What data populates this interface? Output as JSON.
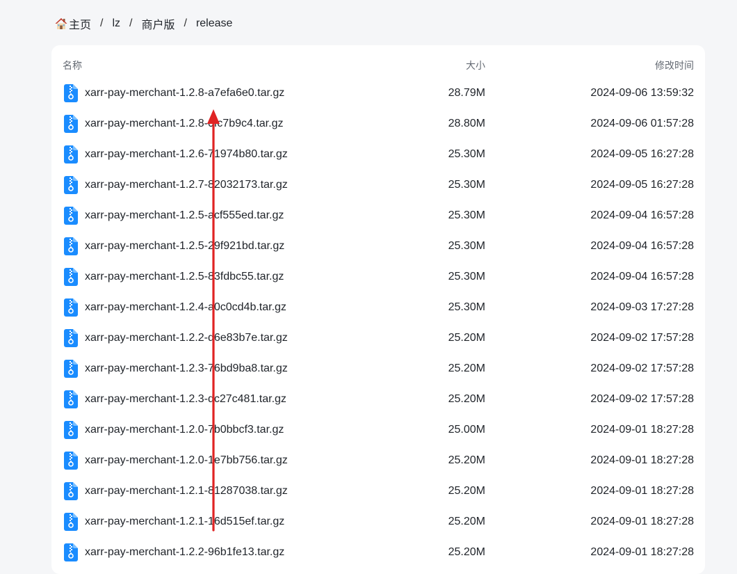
{
  "breadcrumb": {
    "home_label": "主页",
    "items": [
      "lz",
      "商户版",
      "release"
    ],
    "separator": "/"
  },
  "table": {
    "headers": {
      "name": "名称",
      "size": "大小",
      "modified": "修改时间"
    },
    "rows": [
      {
        "name": "xarr-pay-merchant-1.2.8-a7efa6e0.tar.gz",
        "size": "28.79M",
        "modified": "2024-09-06 13:59:32"
      },
      {
        "name": "xarr-pay-merchant-1.2.8-0fc7b9c4.tar.gz",
        "size": "28.80M",
        "modified": "2024-09-06 01:57:28"
      },
      {
        "name": "xarr-pay-merchant-1.2.6-71974b80.tar.gz",
        "size": "25.30M",
        "modified": "2024-09-05 16:27:28"
      },
      {
        "name": "xarr-pay-merchant-1.2.7-82032173.tar.gz",
        "size": "25.30M",
        "modified": "2024-09-05 16:27:28"
      },
      {
        "name": "xarr-pay-merchant-1.2.5-acf555ed.tar.gz",
        "size": "25.30M",
        "modified": "2024-09-04 16:57:28"
      },
      {
        "name": "xarr-pay-merchant-1.2.5-29f921bd.tar.gz",
        "size": "25.30M",
        "modified": "2024-09-04 16:57:28"
      },
      {
        "name": "xarr-pay-merchant-1.2.5-83fdbc55.tar.gz",
        "size": "25.30M",
        "modified": "2024-09-04 16:57:28"
      },
      {
        "name": "xarr-pay-merchant-1.2.4-a0c0cd4b.tar.gz",
        "size": "25.30M",
        "modified": "2024-09-03 17:27:28"
      },
      {
        "name": "xarr-pay-merchant-1.2.2-d6e83b7e.tar.gz",
        "size": "25.20M",
        "modified": "2024-09-02 17:57:28"
      },
      {
        "name": "xarr-pay-merchant-1.2.3-76bd9ba8.tar.gz",
        "size": "25.20M",
        "modified": "2024-09-02 17:57:28"
      },
      {
        "name": "xarr-pay-merchant-1.2.3-dc27c481.tar.gz",
        "size": "25.20M",
        "modified": "2024-09-02 17:57:28"
      },
      {
        "name": "xarr-pay-merchant-1.2.0-7b0bbcf3.tar.gz",
        "size": "25.00M",
        "modified": "2024-09-01 18:27:28"
      },
      {
        "name": "xarr-pay-merchant-1.2.0-1e7bb756.tar.gz",
        "size": "25.20M",
        "modified": "2024-09-01 18:27:28"
      },
      {
        "name": "xarr-pay-merchant-1.2.1-81287038.tar.gz",
        "size": "25.20M",
        "modified": "2024-09-01 18:27:28"
      },
      {
        "name": "xarr-pay-merchant-1.2.1-16d515ef.tar.gz",
        "size": "25.20M",
        "modified": "2024-09-01 18:27:28"
      },
      {
        "name": "xarr-pay-merchant-1.2.2-96b1fe13.tar.gz",
        "size": "25.20M",
        "modified": "2024-09-01 18:27:28"
      }
    ]
  },
  "icons": {
    "home": "house-icon",
    "file": "zip-file-icon"
  },
  "colors": {
    "file_icon": "#1a8cff",
    "annotation_arrow": "#e02424",
    "background": "#f5f6f8",
    "panel": "#ffffff"
  }
}
